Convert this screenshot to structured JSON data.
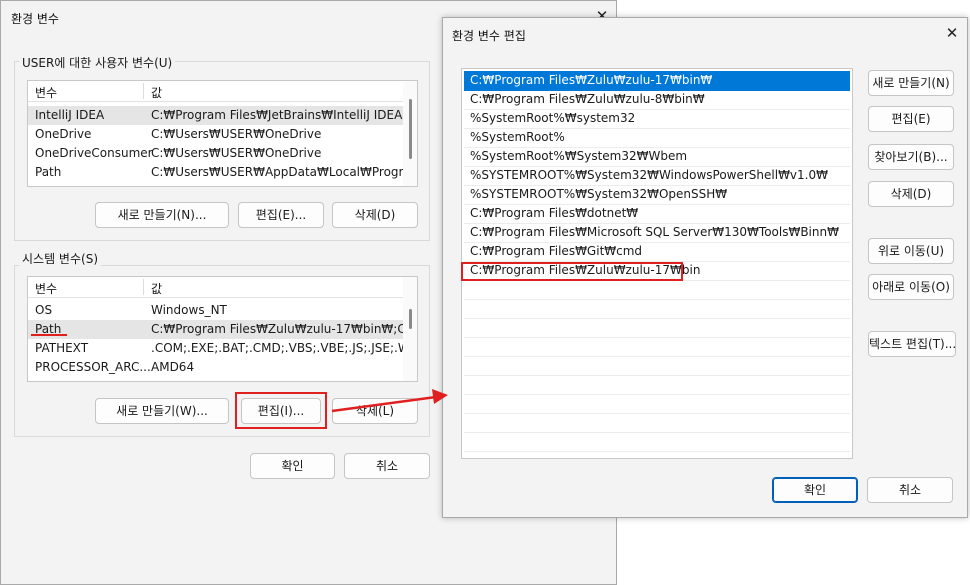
{
  "left_dialog": {
    "title": "환경 변수",
    "user_group": {
      "label": "USER에 대한 사용자 변수(U)",
      "columns": [
        "변수",
        "값"
      ],
      "rows": [
        {
          "name": "IntelliJ IDEA",
          "value": "C:₩Program Files₩JetBrains₩IntelliJ IDEA 2..."
        },
        {
          "name": "OneDrive",
          "value": "C:₩Users₩USER₩OneDrive"
        },
        {
          "name": "OneDriveConsumer",
          "value": "C:₩Users₩USER₩OneDrive"
        },
        {
          "name": "Path",
          "value": "C:₩Users₩USER₩AppData₩Local₩Program..."
        }
      ],
      "buttons": {
        "new": "새로 만들기(N)...",
        "edit": "편집(E)...",
        "delete": "삭제(D)"
      }
    },
    "system_group": {
      "label": "시스템 변수(S)",
      "columns": [
        "변수",
        "값"
      ],
      "rows": [
        {
          "name": "OS",
          "value": "Windows_NT"
        },
        {
          "name": "Path",
          "value": "C:₩Program Files₩Zulu₩zulu-17₩bin₩;C:..."
        },
        {
          "name": "PATHEXT",
          "value": ".COM;.EXE;.BAT;.CMD;.VBS;.VBE;.JS;.JSE;.W..."
        },
        {
          "name": "PROCESSOR_ARC...",
          "value": "AMD64"
        }
      ],
      "buttons": {
        "new": "새로 만들기(W)...",
        "edit": "편집(I)...",
        "delete": "삭제(L)"
      }
    },
    "ok": "확인",
    "cancel": "취소"
  },
  "right_dialog": {
    "title": "환경 변수 편집",
    "paths": [
      "C:₩Program Files₩Zulu₩zulu-17₩bin₩",
      "C:₩Program Files₩Zulu₩zulu-8₩bin₩",
      "%SystemRoot%₩system32",
      "%SystemRoot%",
      "%SystemRoot%₩System32₩Wbem",
      "%SYSTEMROOT%₩System32₩WindowsPowerShell₩v1.0₩",
      "%SYSTEMROOT%₩System32₩OpenSSH₩",
      "C:₩Program Files₩dotnet₩",
      "C:₩Program Files₩Microsoft SQL Server₩130₩Tools₩Binn₩",
      "C:₩Program Files₩Git₩cmd",
      "C:₩Program Files₩Zulu₩zulu-17₩bin"
    ],
    "side_buttons": {
      "new": "새로 만들기(N)",
      "edit": "편집(E)",
      "browse": "찾아보기(B)...",
      "delete": "삭제(D)",
      "move_up": "위로 이동(U)",
      "move_down": "아래로 이동(O)",
      "edit_text": "텍스트 편집(T)..."
    },
    "ok": "확인",
    "cancel": "취소"
  },
  "colors": {
    "selection": "#0078d7",
    "annotation": "#e02020"
  }
}
